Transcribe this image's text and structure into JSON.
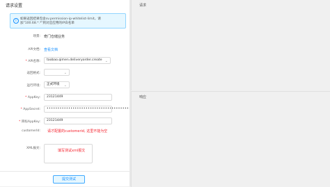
{
  "left_panel": {
    "title": "请求设置",
    "notice": "如果返回结果包含sv.permission-ip-whitelist-limit，请加\"100.68.*.*\"到对应应用的IP白名单",
    "fields": {
      "scene": {
        "label": "场景:",
        "value": "奇门仓储业务"
      },
      "api_doc": {
        "label": "API文档:",
        "value": "查看文档"
      },
      "api_name": {
        "label": "API名称:",
        "value": "taobao.qimen.deliveryorder.create"
      },
      "return_format": {
        "label": "返回格式:",
        "value": ""
      },
      "env": {
        "label": "运行环境:",
        "value": "正式环境"
      },
      "appkey": {
        "label": "AppKey:",
        "value": "23121449"
      },
      "appsecret": {
        "label": "AppSecret:",
        "value": "•••••••••••••••••••••••••••••••••••••••"
      },
      "target_appkey": {
        "label": "目标AppKey:",
        "value": "23121449"
      },
      "customerid": {
        "label": "customerId:",
        "warning": "请才配置的customerid, 这里不能为空"
      },
      "xml": {
        "label": "XML报文:",
        "placeholder": "填写测试xml报文"
      }
    },
    "submit_label": "提交测试"
  },
  "right_panel": {
    "request_title": "请求",
    "response_title": "响应"
  }
}
